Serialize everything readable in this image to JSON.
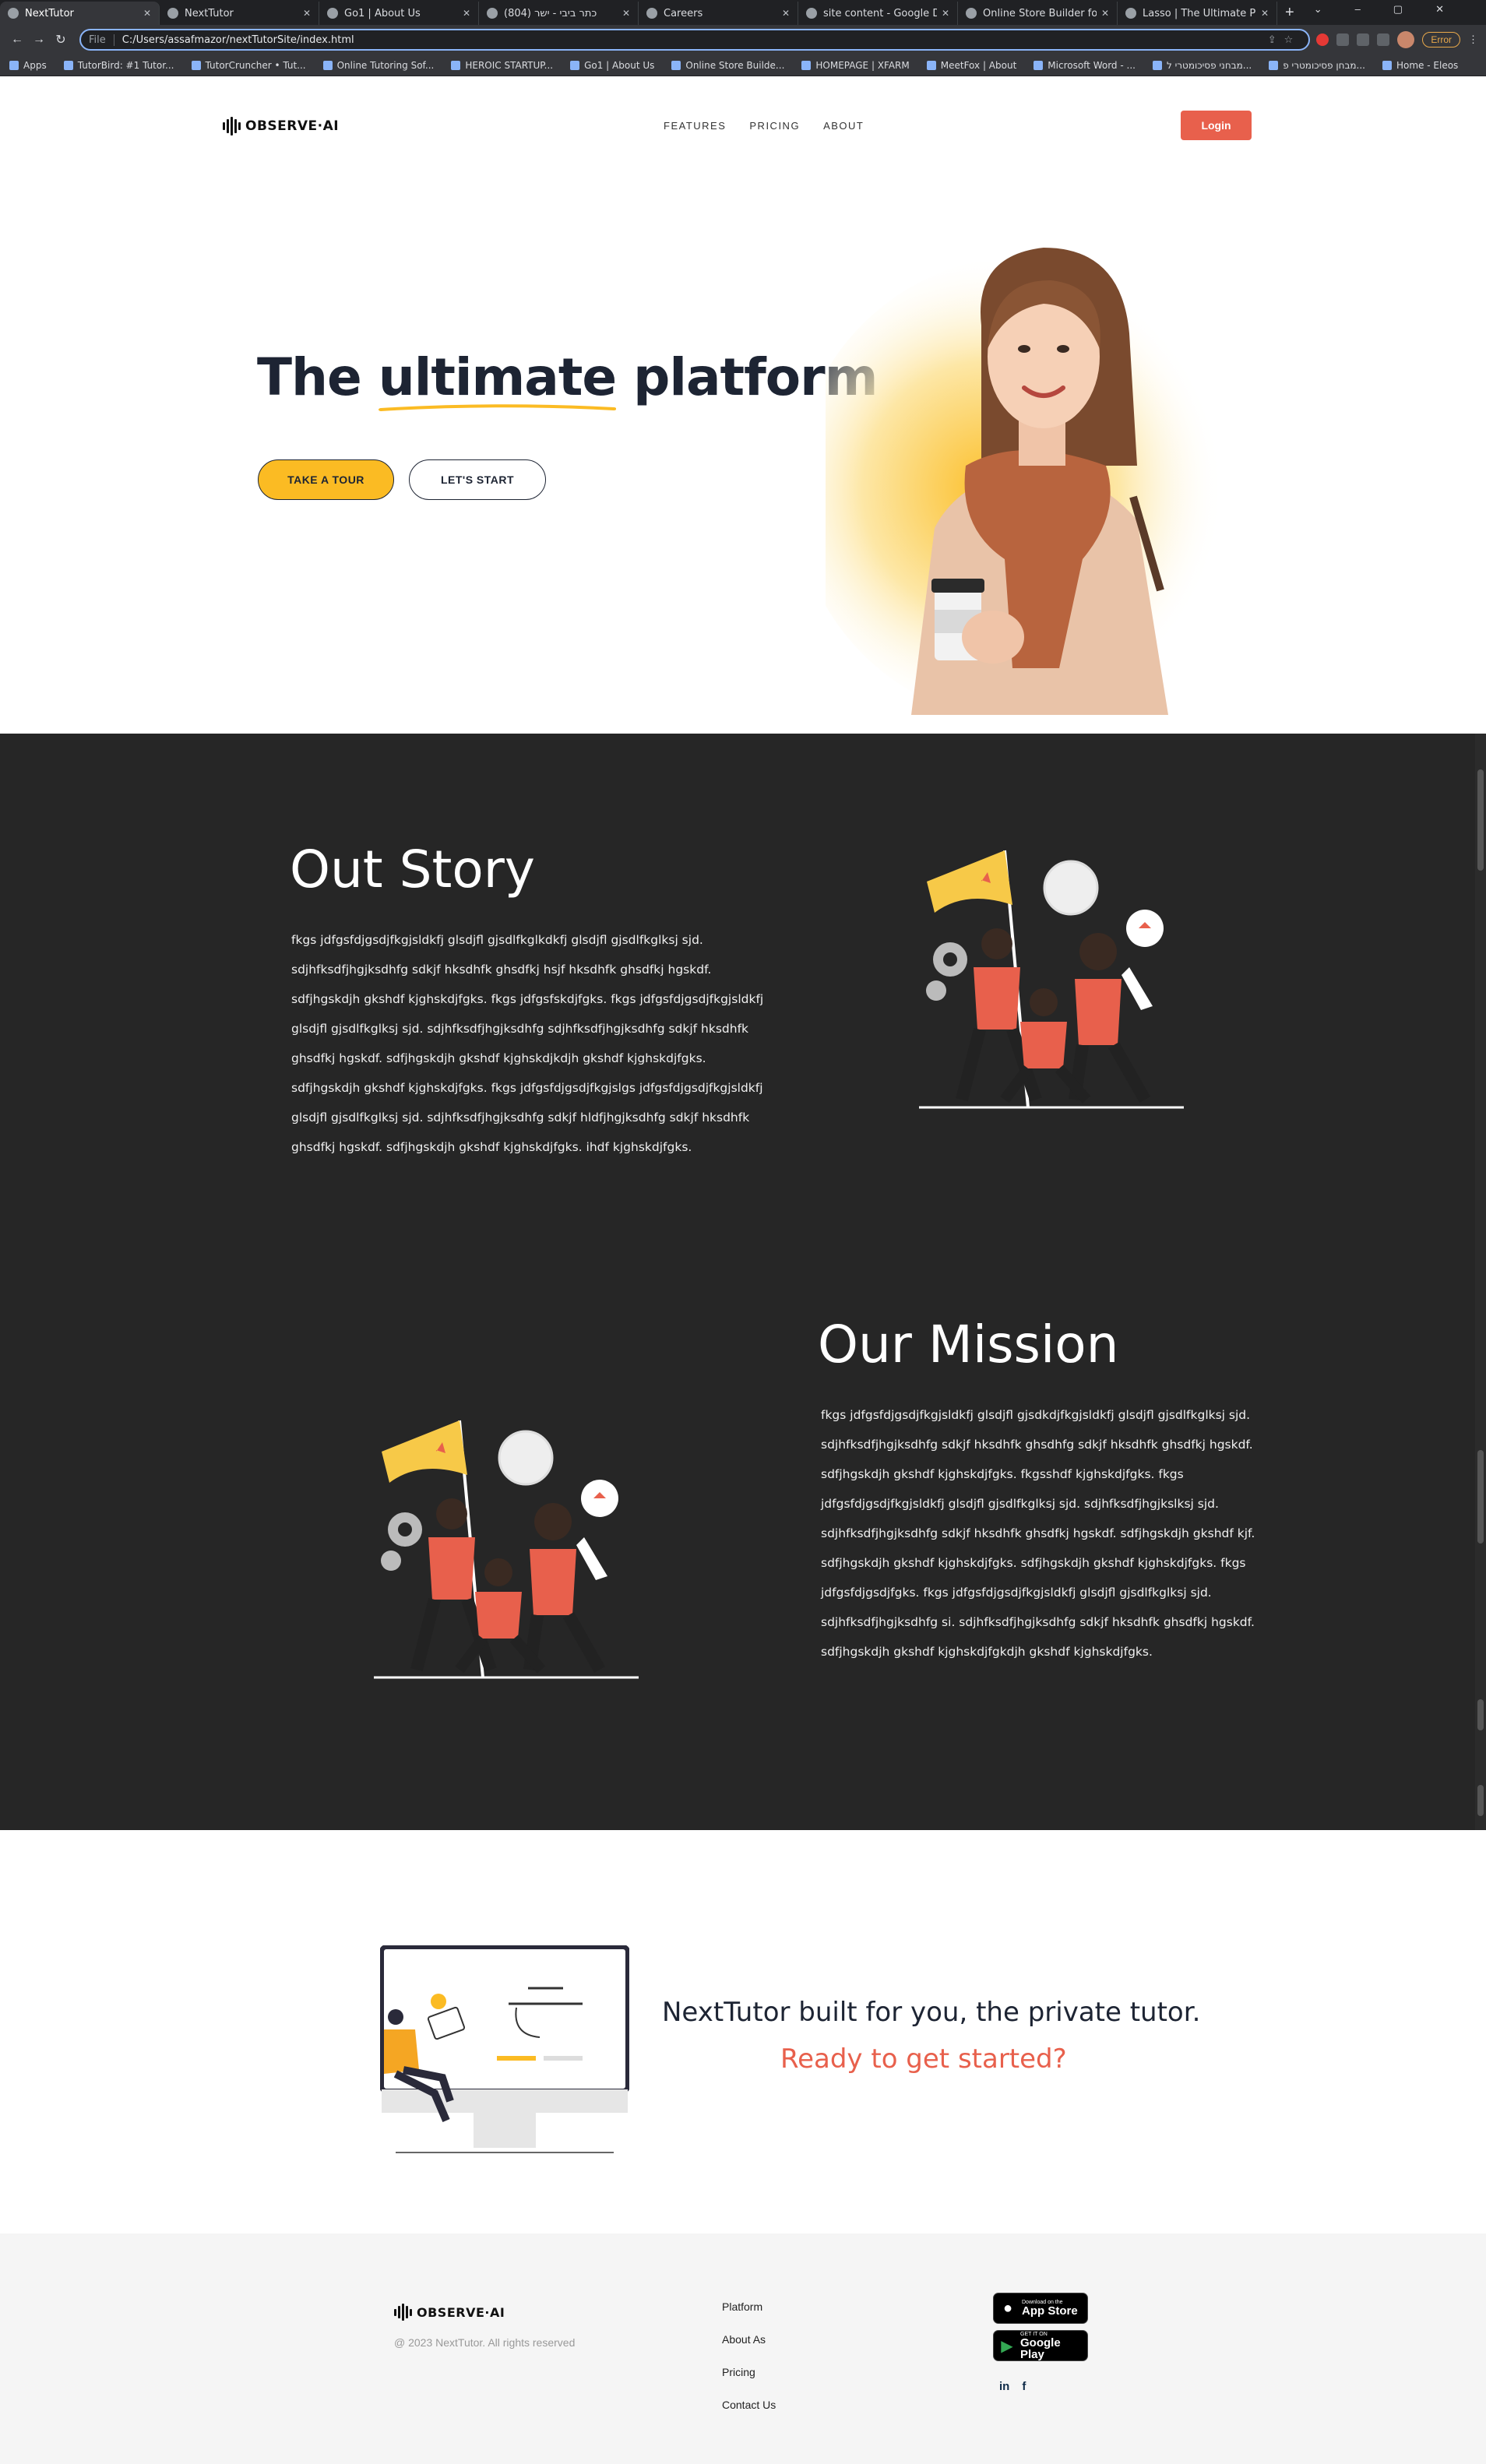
{
  "browser": {
    "tabs": [
      {
        "label": "NextTutor",
        "active": true
      },
      {
        "label": "NextTutor",
        "active": false
      },
      {
        "label": "Go1 | About Us",
        "active": false
      },
      {
        "label": "(804) כתר ביבי - ישר",
        "active": false
      },
      {
        "label": "Careers",
        "active": false
      },
      {
        "label": "site content - Google Docs",
        "active": false
      },
      {
        "label": "Online Store Builder for Re",
        "active": false
      },
      {
        "label": "Lasso | The Ultimate Platfo",
        "active": false
      }
    ],
    "address": {
      "chip": "File",
      "url": "C:/Users/assafmazor/nextTutorSite/index.html"
    },
    "error_label": "Error",
    "bookmarks": [
      "Apps",
      "TutorBird: #1 Tutor...",
      "TutorCruncher • Tut...",
      "Online Tutoring Sof...",
      "HEROIC STARTUP...",
      "Go1 | About Us",
      "Online Store Builde...",
      "HOMEPAGE | XFARM",
      "MeetFox | About",
      "Microsoft Word - ...",
      "מבחני פסיכומטרי ל...",
      "מבחן פסיכומטרי פ...",
      "Home - Eleos"
    ]
  },
  "header": {
    "logo_text": "OBSERVE·AI",
    "menu": [
      "FEATURES",
      "PRICING",
      "ABOUT"
    ],
    "login_label": "Login"
  },
  "hero": {
    "title_pre": "The ",
    "title_highlight": "ultimate",
    "title_post": " platform",
    "tour_label": "TAKE A TOUR",
    "start_label": "LET'S START"
  },
  "story": {
    "title": "Out Story",
    "body": "fkgs jdfgsfdjgsdjfkgjsldkfj glsdjfl gjsdlfkglkdkfj glsdjfl gjsdlfkglksj sjd. sdjhfksdfjhgjksdhfg sdkjf hksdhfk ghsdfkj hsjf hksdhfk ghsdfkj hgskdf. sdfjhgskdjh gkshdf kjghskdjfgks. fkgs jdfgsfskdjfgks. fkgs jdfgsfdjgsdjfkgjsldkfj glsdjfl gjsdlfkglksj sjd. sdjhfksdfjhgjksdhfg sdjhfksdfjhgjksdhfg sdkjf hksdhfk ghsdfkj hgskdf. sdfjhgskdjh gkshdf kjghskdjkdjh gkshdf kjghskdjfgks. sdfjhgskdjh gkshdf kjghskdjfgks. fkgs jdfgsfdjgsdjfkgjslgs jdfgsfdjgsdjfkgjsldkfj glsdjfl gjsdlfkglksj sjd. sdjhfksdfjhgjksdhfg sdkjf hldfjhgjksdhfg sdkjf hksdhfk ghsdfkj hgskdf. sdfjhgskdjh gkshdf kjghskdjfgks.     ihdf kjghskdjfgks."
  },
  "mission": {
    "title": "Our Mission",
    "body": "fkgs jdfgsfdjgsdjfkgjsldkfj glsdjfl gjsdkdjfkgjsldkfj glsdjfl gjsdlfkglksj sjd. sdjhfksdfjhgjksdhfg sdkjf hksdhfk ghsdhfg sdkjf hksdhfk ghsdfkj hgskdf. sdfjhgskdjh gkshdf kjghskdjfgks. fkgsshdf kjghskdjfgks. fkgs jdfgsfdjgsdjfkgjsldkfj glsdjfl gjsdlfkglksj sjd. sdjhfksdfjhgjkslksj sjd. sdjhfksdfjhgjksdhfg sdkjf hksdhfk ghsdfkj hgskdf. sdfjhgskdjh gkshdf kjf. sdfjhgskdjh gkshdf kjghskdjfgks. sdfjhgskdjh gkshdf kjghskdjfgks. fkgs jdfgsfdjgsdjfgks. fkgs jdfgsfdjgsdjfkgjsldkfj glsdjfl gjsdlfkglksj sjd. sdjhfksdfjhgjksdhfg si. sdjhfksdfjhgjksdhfg sdkjf hksdhfk ghsdfkj hgskdf. sdfjhgskdjh gkshdf kjghskdjfgkdjh gkshdf kjghskdjfgks."
  },
  "cta": {
    "line1": "NextTutor built for you, the private tutor.",
    "line2": "Ready to get started?"
  },
  "footer": {
    "logo_text": "OBSERVE·AI",
    "copyright": "@ 2023 NextTutor. All rights reserved",
    "links": [
      "Platform",
      "About As",
      "Pricing",
      "Contact Us"
    ],
    "app_store": {
      "small": "Download on the",
      "big": "App Store"
    },
    "google_play": {
      "small": "GET IT ON",
      "big": "Google Play"
    },
    "social": [
      "in",
      "f"
    ]
  },
  "colors": {
    "accent": "#e8604c",
    "yellow": "#fbbb23",
    "navy": "#1d2433",
    "dark_bg": "#262626"
  }
}
